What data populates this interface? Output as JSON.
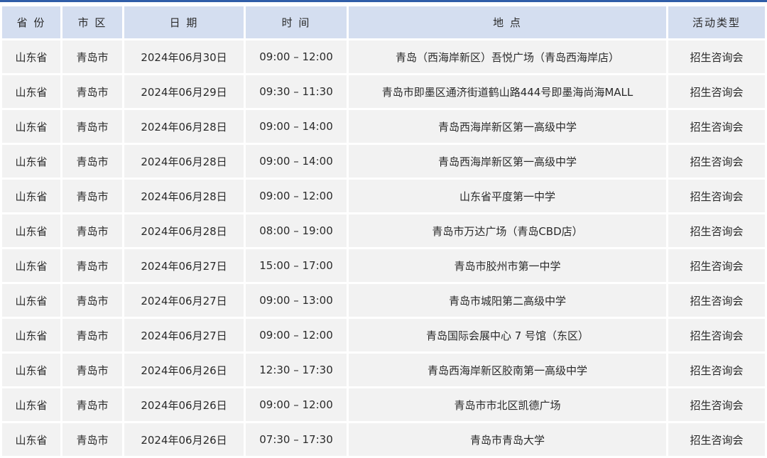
{
  "table": {
    "headers": [
      "省 份",
      "市 区",
      "日 期",
      "时 间",
      "地 点",
      "活动类型"
    ],
    "rows": [
      [
        "山东省",
        "青岛市",
        "2024年06月30日",
        "09:00 – 12:00",
        "青岛（西海岸新区）吾悦广场（青岛西海岸店）",
        "招生咨询会"
      ],
      [
        "山东省",
        "青岛市",
        "2024年06月29日",
        "09:30 – 11:30",
        "青岛市即墨区通济街道鹤山路444号即墨海尚海MALL",
        "招生咨询会"
      ],
      [
        "山东省",
        "青岛市",
        "2024年06月28日",
        "09:00 – 14:00",
        "青岛西海岸新区第一高级中学",
        "招生咨询会"
      ],
      [
        "山东省",
        "青岛市",
        "2024年06月28日",
        "09:00 – 14:00",
        "青岛西海岸新区第一高级中学",
        "招生咨询会"
      ],
      [
        "山东省",
        "青岛市",
        "2024年06月28日",
        "09:00 – 12:00",
        "山东省平度第一中学",
        "招生咨询会"
      ],
      [
        "山东省",
        "青岛市",
        "2024年06月28日",
        "08:00 – 19:00",
        "青岛市万达广场（青岛CBD店）",
        "招生咨询会"
      ],
      [
        "山东省",
        "青岛市",
        "2024年06月27日",
        "15:00 – 17:00",
        "青岛市胶州市第一中学",
        "招生咨询会"
      ],
      [
        "山东省",
        "青岛市",
        "2024年06月27日",
        "09:00 – 13:00",
        "青岛市城阳第二高级中学",
        "招生咨询会"
      ],
      [
        "山东省",
        "青岛市",
        "2024年06月27日",
        "09:00 – 12:00",
        "青岛国际会展中心 7 号馆（东区）",
        "招生咨询会"
      ],
      [
        "山东省",
        "青岛市",
        "2024年06月26日",
        "12:30 – 17:30",
        "青岛西海岸新区胶南第一高级中学",
        "招生咨询会"
      ],
      [
        "山东省",
        "青岛市",
        "2024年06月26日",
        "09:00 – 12:00",
        "青岛市市北区凯德广场",
        "招生咨询会"
      ],
      [
        "山东省",
        "青岛市",
        "2024年06月26日",
        "07:30 – 17:30",
        "青岛市青岛大学",
        "招生咨询会"
      ]
    ]
  },
  "colors": {
    "accent": "#2f5da8",
    "header_bg": "#d4def0",
    "cell_bg": "#f2f2f2",
    "text": "#2a2a2a"
  }
}
